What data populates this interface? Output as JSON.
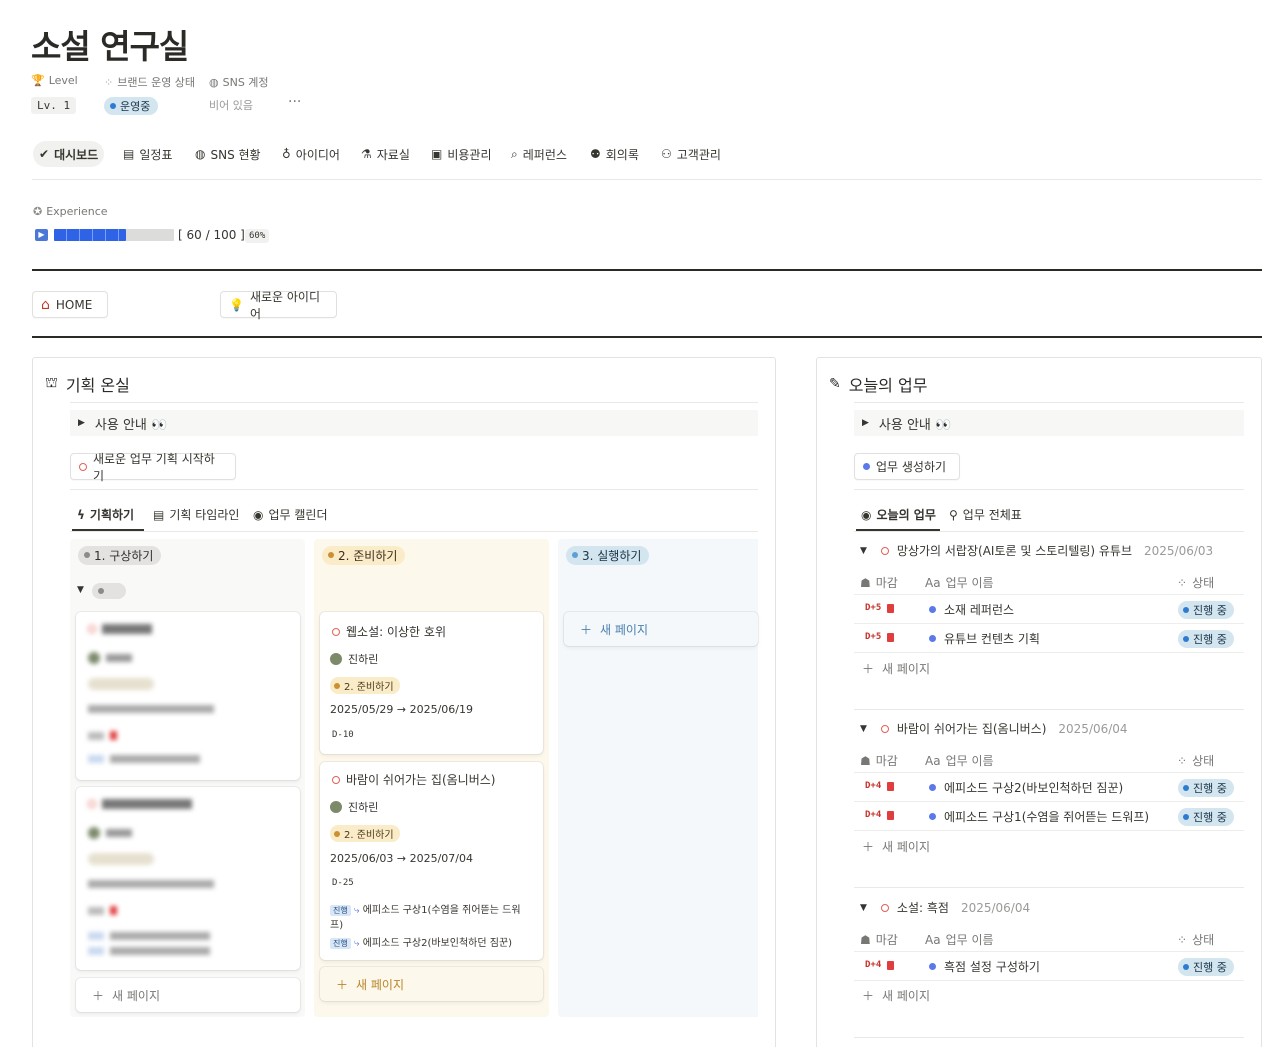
{
  "page": {
    "title": "소설 연구실"
  },
  "properties": {
    "level": {
      "label": "Level",
      "value": "Lv. 1"
    },
    "brand_status": {
      "label": "브랜드 운영 상태",
      "value": "운영중"
    },
    "sns": {
      "label": "SNS 계정",
      "value": "비어 있음"
    },
    "more": "···"
  },
  "tabs": [
    {
      "label": "대시보드",
      "icon": "check-badge-icon"
    },
    {
      "label": "일정표",
      "icon": "calendar-icon"
    },
    {
      "label": "SNS 현황",
      "icon": "globe-icon"
    },
    {
      "label": "아이디어",
      "icon": "lightbulb-icon"
    },
    {
      "label": "자료실",
      "icon": "flask-icon"
    },
    {
      "label": "비용관리",
      "icon": "money-icon"
    },
    {
      "label": "레퍼런스",
      "icon": "search-icon"
    },
    {
      "label": "회의록",
      "icon": "meeting-icon"
    },
    {
      "label": "고객관리",
      "icon": "people-icon"
    }
  ],
  "experience": {
    "label": "Experience",
    "text": "[ 60 / 100 ]",
    "percent_label": "60%",
    "progress": 0.6
  },
  "links": {
    "home": "HOME",
    "idea": "새로운 아이디어"
  },
  "left_panel": {
    "title": "기획 온실",
    "guide": "사용 안내 👀",
    "start_button": "새로운 업무 기획 시작하기",
    "views": [
      "기획하기",
      "기획 타임라인",
      "업무 캘린더"
    ],
    "columns": [
      {
        "label": "1. 구상하기"
      },
      {
        "label": "2. 준비하기"
      },
      {
        "label": "3. 실행하기"
      }
    ],
    "cards": [
      {
        "title": "웹소설: 이상한 호위",
        "person": "진하린",
        "status": "2. 준비하기",
        "dates": "2025/05/29 → 2025/06/19",
        "dday": "D-10"
      },
      {
        "title": "바람이 쉬어가는 집(옴니버스)",
        "person": "진하린",
        "status": "2. 준비하기",
        "dates": "2025/06/03 → 2025/07/04",
        "dday": "D-25",
        "tasks": [
          {
            "tag": "진행",
            "text": "에피소드 구상1(수염을 쥐어뜯는 드워프)"
          },
          {
            "tag": "진행",
            "text": "에피소드 구상2(바보인척하던 짐꾼)"
          }
        ]
      }
    ],
    "new_page": "새 페이지"
  },
  "right_panel": {
    "title": "오늘의 업무",
    "guide": "사용 안내 👀",
    "create_button": "업무 생성하기",
    "views": [
      "오늘의 업무",
      "업무 전체표"
    ],
    "headers": {
      "deadline": "마감",
      "name": "업무 이름",
      "status": "상태",
      "aa": "Aa"
    },
    "groups": [
      {
        "title": "망상가의 서랍장(AI토론 및 스토리텔링) 유튜브",
        "date": "2025/06/03",
        "rows": [
          {
            "dday": "D+5",
            "name": "소재 레퍼런스",
            "status": "진행 중"
          },
          {
            "dday": "D+5",
            "name": "유튜브 컨텐츠 기획",
            "status": "진행 중"
          }
        ]
      },
      {
        "title": "바람이 쉬어가는 집(옴니버스)",
        "date": "2025/06/04",
        "rows": [
          {
            "dday": "D+4",
            "name": "에피소드 구상2(바보인척하던 짐꾼)",
            "status": "진행 중"
          },
          {
            "dday": "D+4",
            "name": "에피소드 구상1(수염을 쥐어뜯는 드워프)",
            "status": "진행 중"
          }
        ]
      },
      {
        "title": "소설: 흑점",
        "date": "2025/06/04",
        "rows": [
          {
            "dday": "D+4",
            "name": "흑점 설정 구성하기",
            "status": "진행 중"
          }
        ]
      }
    ],
    "new_page": "새 페이지"
  },
  "colors": {
    "accent_blue": "#2e63e6",
    "status_blue_bg": "#d3e5ef",
    "yellow_bg": "#fbecc9",
    "red": "#e16259"
  }
}
